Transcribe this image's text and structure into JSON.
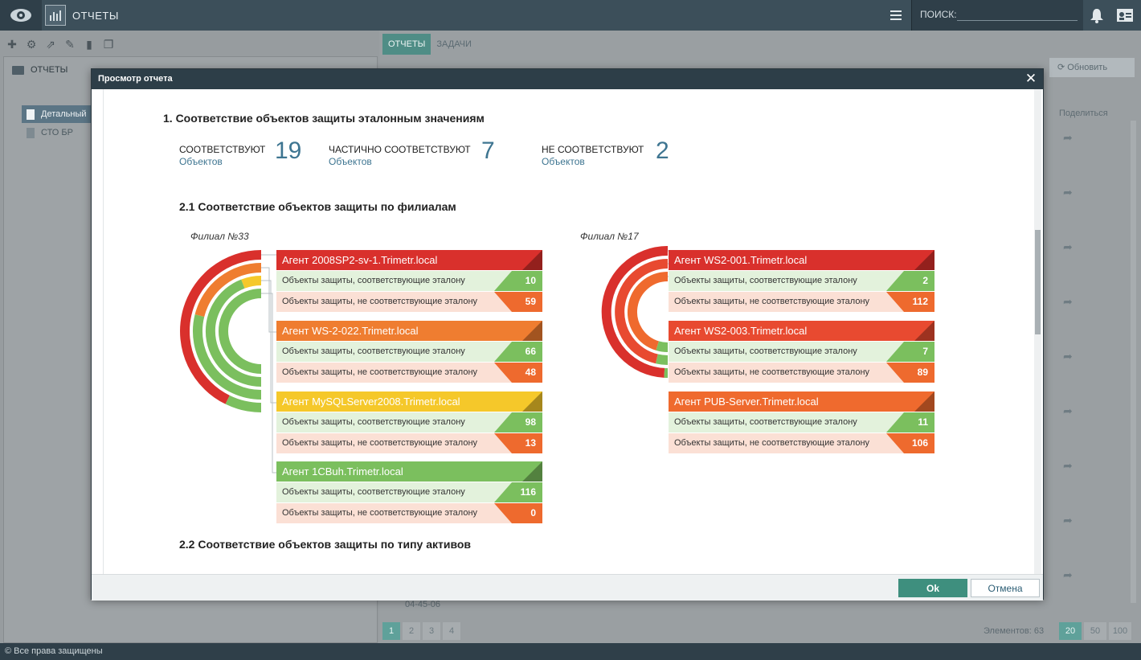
{
  "app": {
    "title": "ОТЧЕТЫ"
  },
  "search": {
    "label": "ПОИСК:",
    "value": ""
  },
  "tree": {
    "root": "ОТЧЕТЫ",
    "items": [
      {
        "label": "Детальный",
        "selected": true
      },
      {
        "label": "СТО БР",
        "selected": false
      }
    ]
  },
  "tabs": [
    {
      "label": "ОТЧЕТЫ",
      "active": true
    },
    {
      "label": "ЗАДАЧИ",
      "active": false
    }
  ],
  "list": {
    "refresh_label": "⟳ Обновить",
    "share_header": "Поделиться",
    "partial_cell": "04-45-06"
  },
  "pager": {
    "pages": [
      "1",
      "2",
      "3",
      "4"
    ],
    "count_label": "Элементов: 63",
    "per_page": [
      "20",
      "50",
      "100"
    ]
  },
  "footer": {
    "text": "© Все права защищены"
  },
  "modal": {
    "title": "Просмотр отчета",
    "ok_label": "Ok",
    "cancel_label": "Отмена",
    "report": {
      "section1_title": "1. Соответствие объектов защиты эталонным значениям",
      "stats": [
        {
          "label": "СООТВЕТСТВУЮТ",
          "sub": "Объектов",
          "value": "19"
        },
        {
          "label": "ЧАСТИЧНО СООТВЕТСТВУЮТ",
          "sub": "Объектов",
          "value": "7"
        },
        {
          "label": "НЕ СООТВЕТСТВУЮТ",
          "sub": "Объектов",
          "value": "2"
        }
      ],
      "section21_title": "2.1 Соответствие объектов защиты по филиалам",
      "section22_title": "2.2 Соответствие объектов защиты по типу активов",
      "row_ok_label": "Объекты защиты, соответствующие эталону",
      "row_bad_label": "Объекты защиты, не соответствующие эталону",
      "branches": [
        {
          "title": "Филиал №33",
          "agents": [
            {
              "name": "Агент 2008SP2-sv-1.Trimetr.local",
              "color": "#d9302c",
              "ok": 10,
              "bad": 59
            },
            {
              "name": "Агент WS-2-022.Trimetr.local",
              "color": "#ef7d30",
              "ok": 66,
              "bad": 48
            },
            {
              "name": "Агент MySQLServer2008.Trimetr.local",
              "color": "#f5c82a",
              "ok": 98,
              "bad": 13
            },
            {
              "name": "Агент 1CBuh.Trimetr.local",
              "color": "#7bbf5e",
              "ok": 116,
              "bad": 0
            }
          ]
        },
        {
          "title": "Филиал №17",
          "agents": [
            {
              "name": "Агент WS2-001.Trimetr.local",
              "color": "#d9302c",
              "ok": 2,
              "bad": 112
            },
            {
              "name": "Агент WS2-003.Trimetr.local",
              "color": "#e84a30",
              "ok": 7,
              "bad": 89
            },
            {
              "name": "Агент PUB-Server.Trimetr.local",
              "color": "#ef6a2e",
              "ok": 11,
              "bad": 106
            }
          ]
        }
      ]
    }
  }
}
